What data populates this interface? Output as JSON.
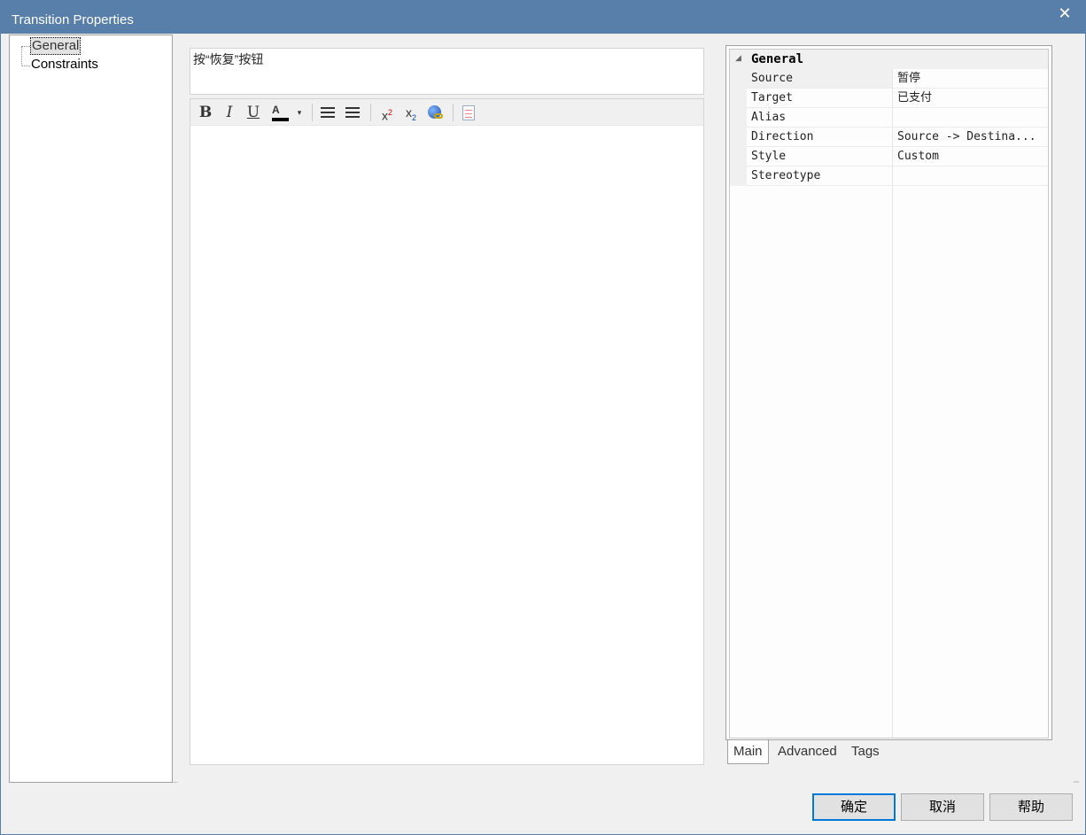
{
  "window": {
    "title": "Transition Properties",
    "close_glyph": "✕"
  },
  "tree": {
    "items": [
      {
        "label": "General",
        "selected": true
      },
      {
        "label": "Constraints",
        "selected": false
      }
    ]
  },
  "notes": {
    "title": "按“恢复”按钮",
    "body": ""
  },
  "toolbar": {
    "bold": "B",
    "italic": "I",
    "underline": "U",
    "font_color_icon": "font-color-icon",
    "dropdown_glyph": "▾",
    "bullet_list_icon": "bullet-list-icon",
    "numbered_list_icon": "numbered-list-icon",
    "superscript_base": "x",
    "superscript_mark": "2",
    "subscript_base": "x",
    "subscript_mark": "2",
    "hyperlink_icon": "hyperlink-globe-icon",
    "document_icon": "document-icon"
  },
  "properties": {
    "group_label": "General",
    "group_glyph": "◢",
    "rows": [
      {
        "key": "Source",
        "value": "暂停"
      },
      {
        "key": "Target",
        "value": "已支付"
      },
      {
        "key": "Alias",
        "value": ""
      },
      {
        "key": "Direction",
        "value": "Source -> Destina..."
      },
      {
        "key": "Style",
        "value": "Custom"
      },
      {
        "key": "Stereotype",
        "value": ""
      }
    ]
  },
  "tabs": [
    {
      "label": "Main",
      "active": true
    },
    {
      "label": "Advanced",
      "active": false
    },
    {
      "label": "Tags",
      "active": false
    }
  ],
  "buttons": {
    "ok": "确定",
    "cancel": "取消",
    "help": "帮助"
  },
  "colors": {
    "titlebar": "#587fa9",
    "accent_focus": "#0078d7"
  }
}
